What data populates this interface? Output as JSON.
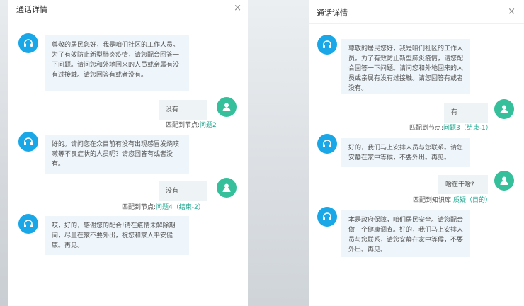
{
  "left": {
    "title": "通话详情",
    "close": "×",
    "messages": {
      "a1": "尊敬的居民您好，我是咱们社区的工作人员。为了有效防止新型肺炎疫情，请您配合回答一下问题。请问您和外地回来的人员或亲属有没有过接触。请您回答有或者没有。",
      "u1": "没有",
      "u1_prefix": "匹配到节点:",
      "u1_link": "问题2",
      "a2": "好的。请问您在众目前有没有出现感冒发烧咳嗽等不良症状的人员呢？请您回答有或者没有。",
      "u2": "没有",
      "u2_prefix": "匹配到节点:",
      "u2_link": "问题4（结束-2）",
      "a3": "哎，好的，感谢您的配合!请在疫情未解除期间，尽量在家不要外出，祝您和家人平安健康。再见。"
    }
  },
  "right": {
    "title": "通话详情",
    "close": "×",
    "messages": {
      "a1": "尊敬的居民您好，我是咱们社区的工作人员。为了有效防止新型肺炎疫情，请您配合回答一下问题。请问您和外地回来的人员或亲属有没有过接触。请您回答有或者没有。",
      "u1": "有",
      "u1_prefix": "匹配到节点:",
      "u1_link": "问题3（结束-1）",
      "a2": "好的，我们马上安排人员与您联系。请您安静在家中等候，不要外出。再见。",
      "u2": "啥在干啥?",
      "u2_prefix": "匹配到知识库:",
      "u2_link": "质疑（目的）",
      "a3": "本是政府保障，咱们居民安全。请您配合做一个健康调查。好的，我们马上安排人员与您联系，请您安静在家中等候，不要外出。再见。"
    }
  },
  "icons": {
    "agent": "headset-icon",
    "user": "user-icon"
  },
  "colors": {
    "agent_avatar": "#1aa7e8",
    "user_avatar": "#35bf9a",
    "link": "#1ba78f",
    "agent_bubble": "#eef6fb",
    "user_bubble": "#eef4f6"
  }
}
